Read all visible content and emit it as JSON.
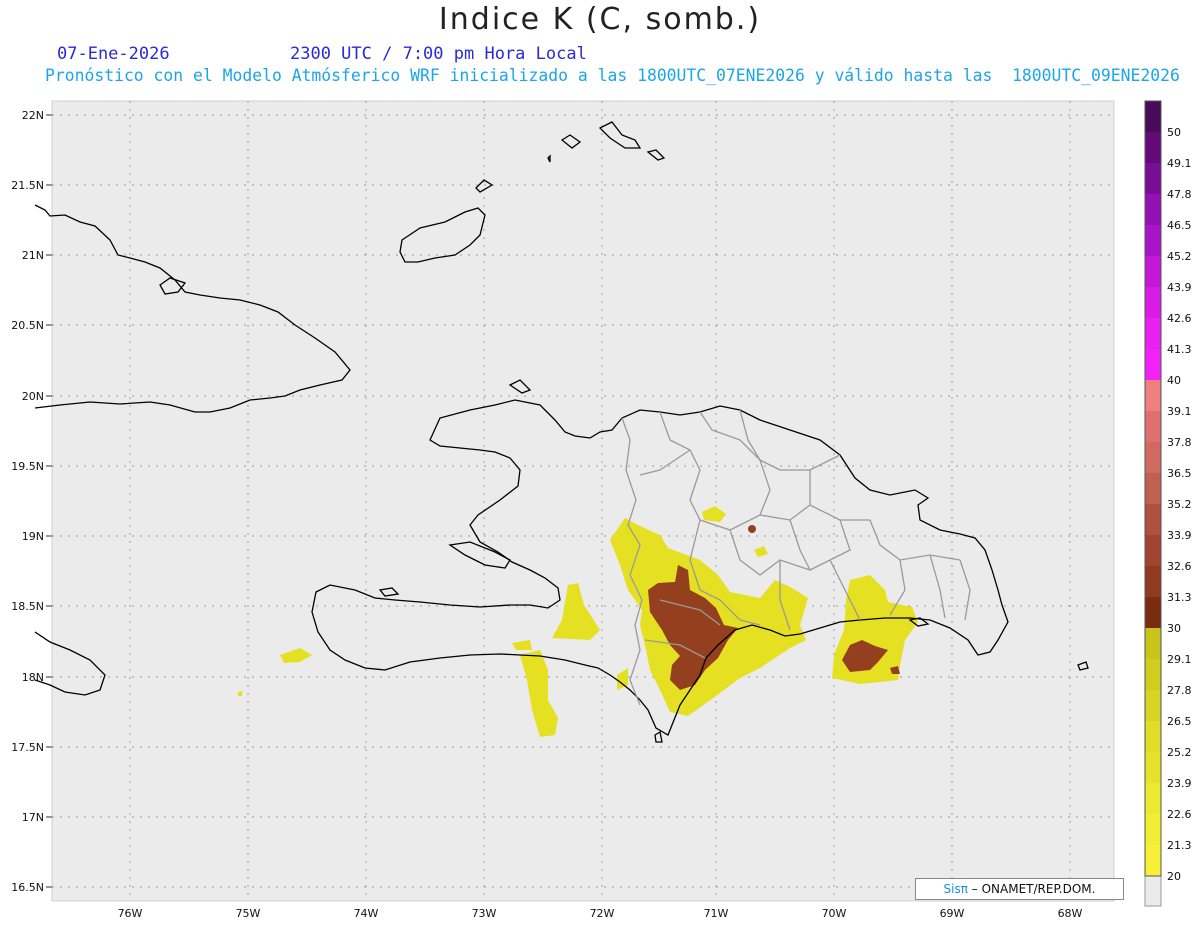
{
  "header": {
    "title": "Indice K (C, somb.)",
    "date": "07-Ene-2026",
    "time": "2300 UTC / 7:00 pm Hora Local",
    "description": "Pronóstico con el Modelo Atmósferico WRF inicializado a las 1800UTC_07ENE2026 y válido hasta las  1800UTC_09ENE2026"
  },
  "axes": {
    "lat_labels": [
      "22N",
      "21.5N",
      "21N",
      "20.5N",
      "20N",
      "19.5N",
      "19N",
      "18.5N",
      "18N",
      "17.5N",
      "17N",
      "16.5N"
    ],
    "lon_labels": [
      "76W",
      "75W",
      "74W",
      "73W",
      "72W",
      "71W",
      "70W",
      "69W",
      "68W"
    ]
  },
  "colorbar": {
    "labels": [
      "50",
      "49.1",
      "47.8",
      "46.5",
      "45.2",
      "43.9",
      "42.6",
      "41.3",
      "40",
      "39.1",
      "37.8",
      "36.5",
      "35.2",
      "33.9",
      "32.6",
      "31.3",
      "30",
      "29.1",
      "27.8",
      "26.5",
      "25.2",
      "23.9",
      "22.6",
      "21.3",
      "20"
    ],
    "colors": [
      "#4a0a5a",
      "#620b78",
      "#7a0d96",
      "#9210b4",
      "#aa14c8",
      "#c418d8",
      "#d81ce6",
      "#e820f0",
      "#f022f8",
      "#f08080",
      "#e07070",
      "#d06a60",
      "#c06050",
      "#b05040",
      "#a04330",
      "#903a22",
      "#7a2c10",
      "#c8c41a",
      "#d0cc20",
      "#d8d424",
      "#e0dc28",
      "#e6e22c",
      "#ecea30",
      "#f2ee34",
      "#f8f038"
    ]
  },
  "credit": {
    "brand": "Sisπ",
    "text": "– ONAMET/REP.DOM."
  },
  "colors": {
    "ocean": "#ebebeb",
    "coast": "#000000",
    "border": "#9a9a9a",
    "k20": "#e6e022",
    "k30": "#94401e"
  }
}
